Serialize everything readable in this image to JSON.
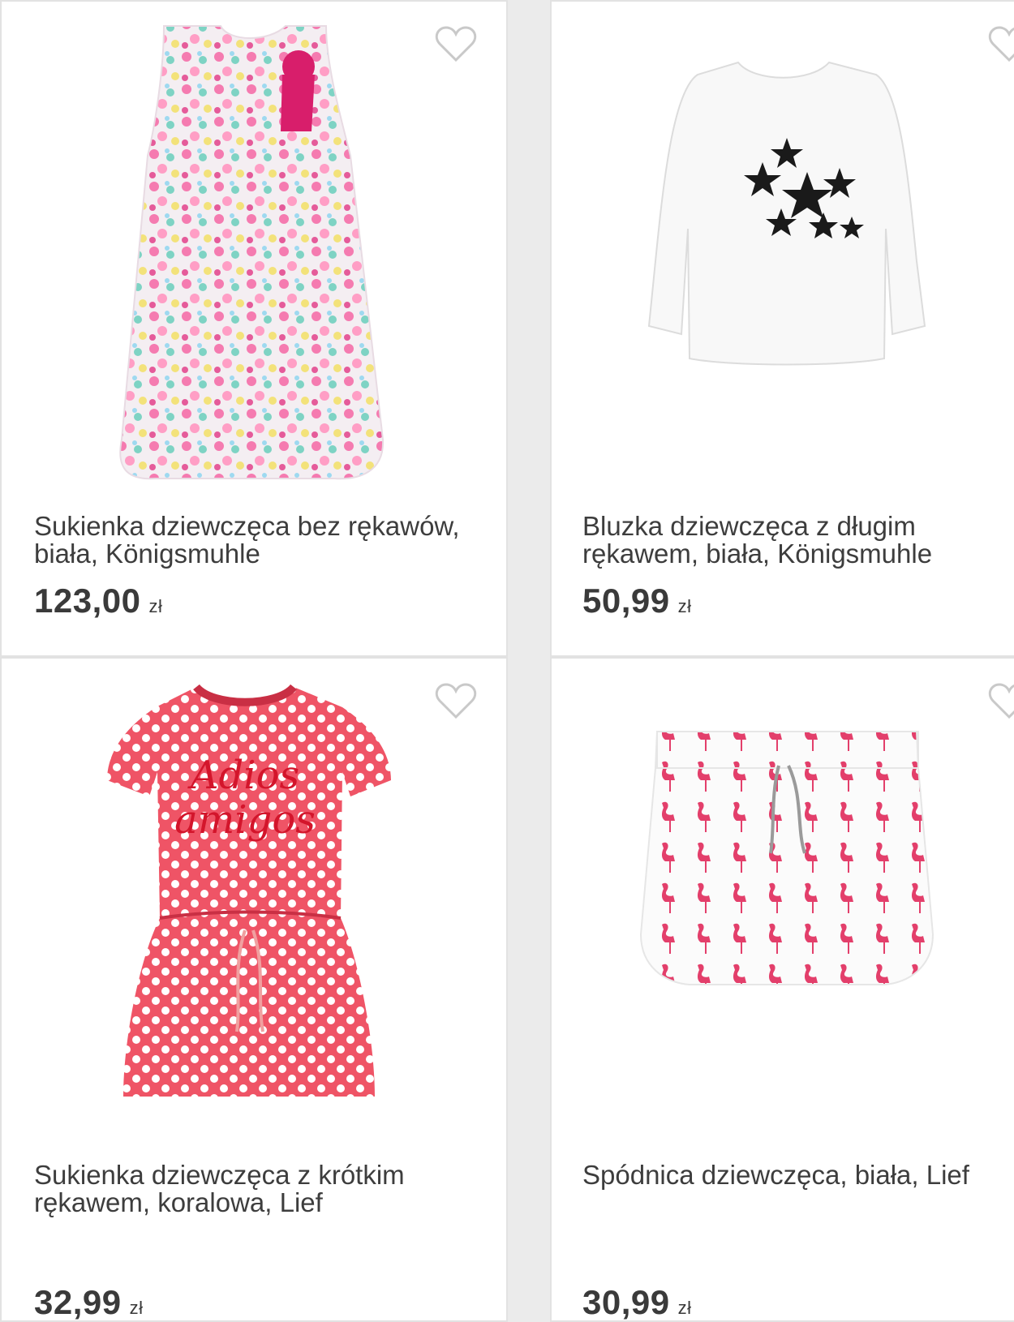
{
  "products": [
    {
      "title": "Sukienka dziewczęca bez rękawów, biała, Königsmuhle",
      "price": "123,00",
      "currency": "zł"
    },
    {
      "title": "Bluzka dziewczęca z długim rękawem, biała, Königsmuhle",
      "price": "50,99",
      "currency": "zł"
    },
    {
      "title": "Sukienka dziewczęca z krótkim rękawem, koralowa, Lief",
      "price": "32,99",
      "currency": "zł"
    },
    {
      "title": "Spódnica dziewczęca, biała, Lief",
      "price": "30,99",
      "currency": "zł"
    }
  ],
  "colors": {
    "accent": "#d9456b",
    "text": "#3a3a3a",
    "border": "#e2e2e2"
  },
  "icons": {
    "favorite": "heart-outline-icon"
  }
}
